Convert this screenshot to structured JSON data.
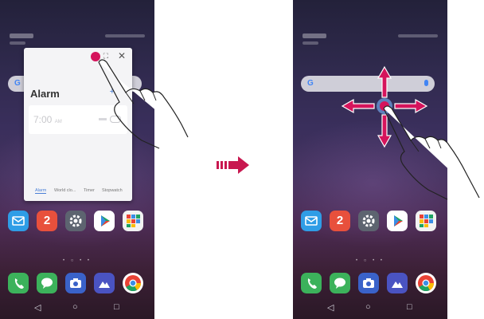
{
  "colors": {
    "accent": "#d5145c",
    "link": "#4a7fd6"
  },
  "left_phone": {
    "popup": {
      "title": "Alarm",
      "alarm_time": "7:00",
      "alarm_ampm": "AM",
      "close_icon": "close-icon",
      "resize_icon": "resize-icon",
      "add_icon": "plus-icon",
      "tabs": [
        "Alarm",
        "World clo...",
        "Timer",
        "Stopwatch"
      ]
    }
  },
  "right_phone": {
    "search_icon": "google-icon",
    "drag_indicator": "four-way-move-arrows"
  },
  "home_apps": [
    {
      "icon": "email-icon",
      "color": "#2f9de6"
    },
    {
      "icon": "calendar-icon",
      "color": "#e8503c",
      "glyph": "2"
    },
    {
      "icon": "settings-icon",
      "color": "#5d6470"
    },
    {
      "icon": "play-store-icon",
      "color": "#ffffff"
    },
    {
      "icon": "google-folder-icon",
      "color": "#f2f2f2"
    }
  ],
  "dock_apps": [
    {
      "icon": "phone-icon",
      "color": "#3cb25b"
    },
    {
      "icon": "messages-icon",
      "color": "#3cb25b"
    },
    {
      "icon": "camera-icon",
      "color": "#3a62c9"
    },
    {
      "icon": "gallery-icon",
      "color": "#4a53c2"
    },
    {
      "icon": "chrome-icon",
      "color": "#ffffff"
    }
  ],
  "nav": {
    "back": "◁",
    "home": "○",
    "recents": "□"
  }
}
